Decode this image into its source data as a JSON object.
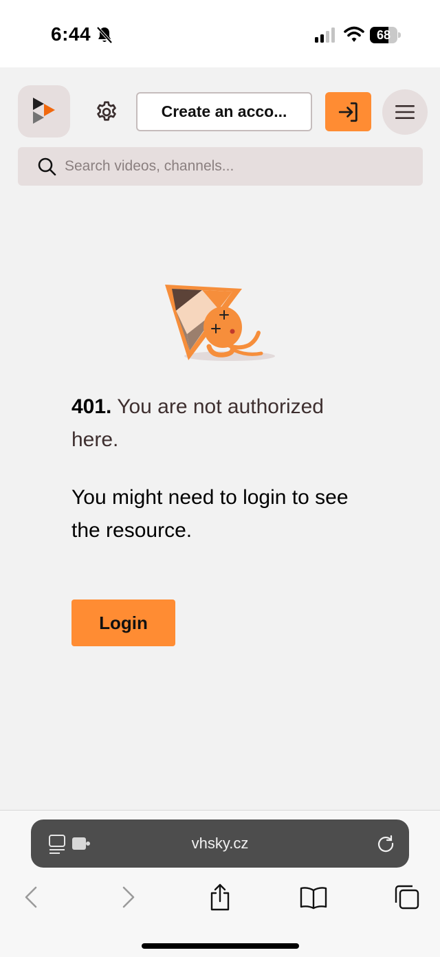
{
  "status_bar": {
    "time": "6:44",
    "battery_percent": "68",
    "battery_level": 0.68
  },
  "header": {
    "create_account_label": "Create an acco...",
    "search_placeholder": "Search videos, channels..."
  },
  "icons": {
    "logo": "peertube-logo-icon",
    "settings": "gear-icon",
    "signin": "sign-in-icon",
    "menu": "hamburger-menu-icon",
    "search": "search-icon"
  },
  "error": {
    "code": "401.",
    "message": "You are not authorized here.",
    "description": "You might need to login to see the resource.",
    "login_label": "Login"
  },
  "browser": {
    "url": "vhsky.cz"
  },
  "colors": {
    "accent": "#ff8c33",
    "header_bg": "#e6dede",
    "page_bg": "#f2f2f2",
    "address_bar_bg": "#4d4d4d"
  }
}
